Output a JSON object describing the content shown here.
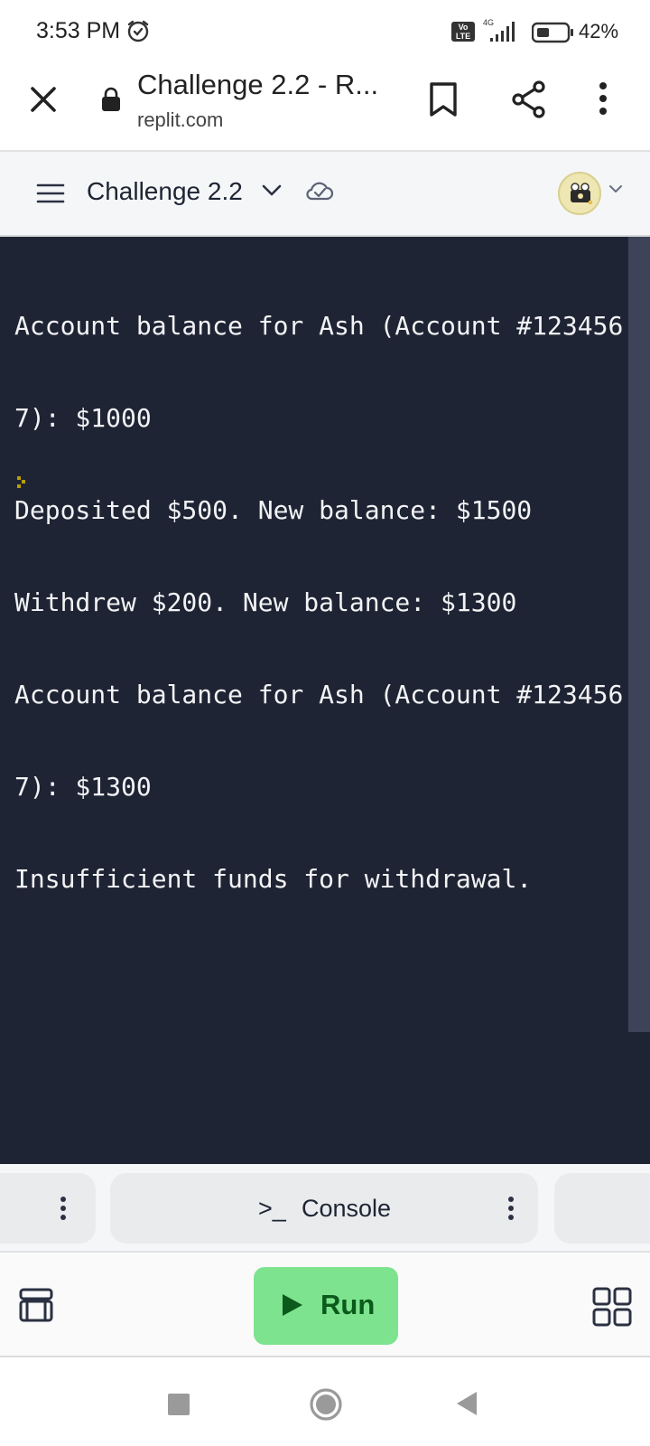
{
  "status_bar": {
    "time": "3:53 PM",
    "network_label": "4G",
    "volte_line1": "Vo",
    "volte_line2": "LTE",
    "battery_percent": "42%",
    "battery_level": 0.42,
    "icons": [
      "alarm-icon",
      "volte-icon",
      "signal-icon",
      "battery-icon"
    ]
  },
  "browser": {
    "page_title": "Challenge 2.2 - R...",
    "domain": "replit.com",
    "icons": [
      "close-icon",
      "lock-icon",
      "bookmark-icon",
      "share-icon",
      "more-vert-icon"
    ]
  },
  "replit_header": {
    "project_name": "Challenge 2.2",
    "icons": [
      "menu-icon",
      "chevron-down-icon",
      "cloud-check-icon",
      "avatar",
      "chevron-down-icon"
    ]
  },
  "console": {
    "lines": [
      "Account balance for Ash (Account #123456",
      "7): $1000",
      "Deposited $500. New balance: $1500",
      "Withdrew $200. New balance: $1300",
      "Account balance for Ash (Account #123456",
      "7): $1300",
      "Insufficient funds for withdrawal."
    ]
  },
  "tabs": {
    "console_prompt": ">_",
    "console_label": "Console"
  },
  "toolbar": {
    "run_label": "Run"
  },
  "colors": {
    "console_bg": "#1f2434",
    "console_text": "#f2f3f5",
    "run_button": "#7de38e",
    "run_text": "#0b5a1c"
  }
}
